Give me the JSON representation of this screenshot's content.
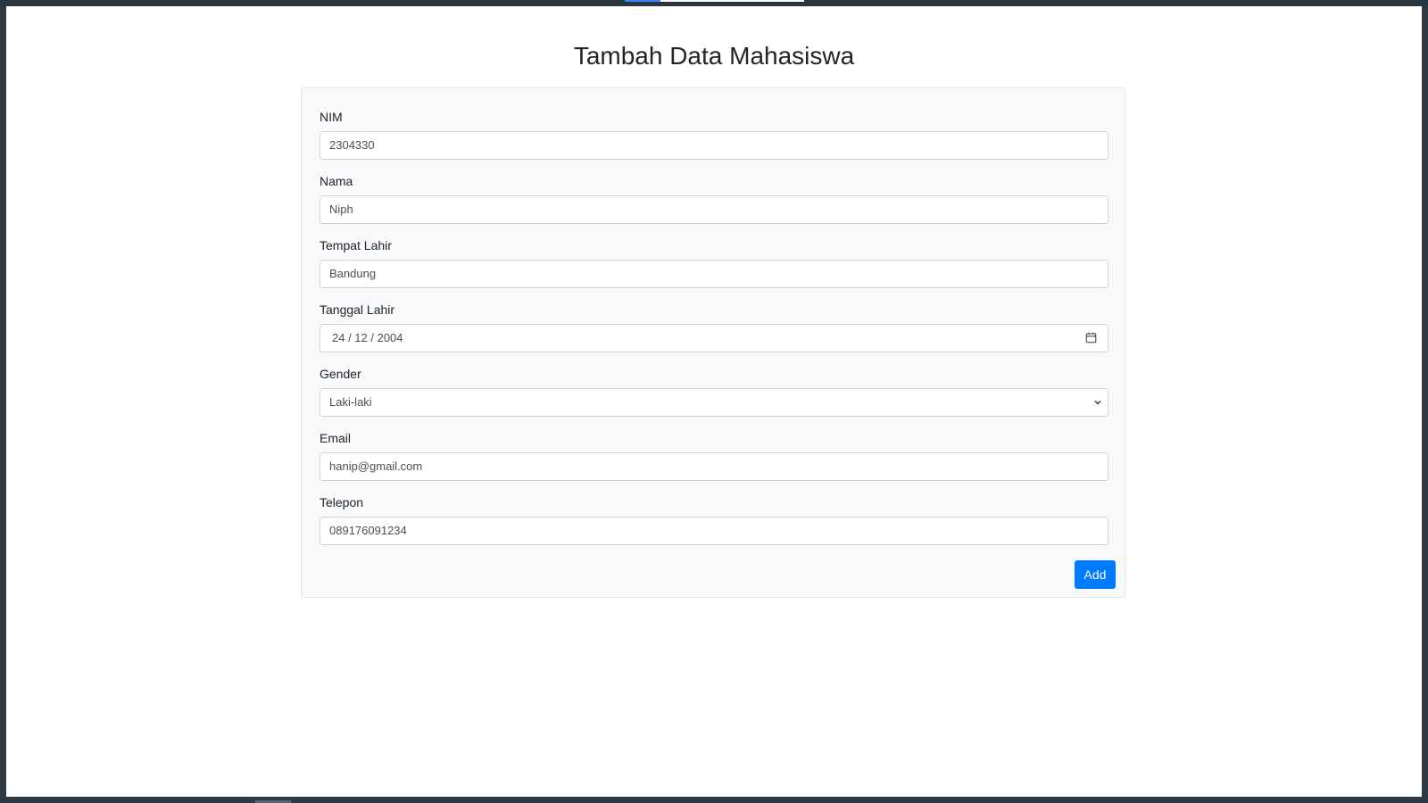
{
  "page": {
    "title": "Tambah Data Mahasiswa"
  },
  "form": {
    "nim": {
      "label": "NIM",
      "value": "2304330"
    },
    "nama": {
      "label": "Nama",
      "value": "Niph"
    },
    "tempat_lahir": {
      "label": "Tempat Lahir",
      "value": "Bandung"
    },
    "tanggal_lahir": {
      "label": "Tanggal Lahir",
      "value": "24 / 12 / 2004",
      "icon": "calendar-icon"
    },
    "gender": {
      "label": "Gender",
      "selected": "Laki-laki",
      "icon": "chevron-down-icon"
    },
    "email": {
      "label": "Email",
      "value": "hanip@gmail.com"
    },
    "telepon": {
      "label": "Telepon",
      "value": "089176091234"
    },
    "submit_label": "Add"
  },
  "colors": {
    "primary": "#007bff",
    "card_background": "#f8f9fa",
    "frame": "#2d3a44"
  }
}
